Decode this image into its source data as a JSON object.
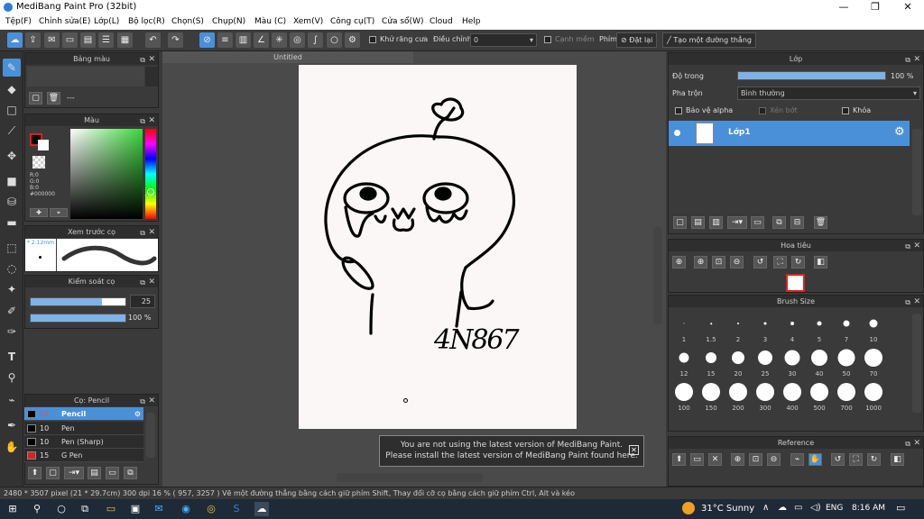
{
  "window": {
    "title": "MediBang Paint Pro (32bit)"
  },
  "menu": [
    "Tệp(F)",
    "Chỉnh sửa(E)",
    "Lớp(L)",
    "Bộ lọc(R)",
    "Chọn(S)",
    "Chụp(N)",
    "Màu (C)",
    "Xem(V)",
    "Công cụ(T)",
    "Cửa sổ(W)",
    "Cloud",
    "Help"
  ],
  "toolbar": {
    "antialias_label": "Khử răng cưa",
    "adjust_label": "Điều chỉnh",
    "adjust_value": "0",
    "soft_edge_label": "Cạnh mềm",
    "key_label": "Phím",
    "reset_label": "Đặt lại",
    "line_label": "Tạo một đường thẳng"
  },
  "panels": {
    "palette": "Bảng màu",
    "palette_item": "---",
    "color": "Màu",
    "color_r": "R:0",
    "color_g": "G:0",
    "color_b": "B:0",
    "color_hex": "#000000",
    "brush_preview": "Xem trước cọ",
    "brush_preview_size": "2.12mm",
    "brush_control": "Kiểm soát cọ",
    "brush_size_value": "25",
    "brush_opacity_value": "100 %",
    "brush_list": "Cọ: Pencil",
    "layer": "Lớp",
    "opacity_label": "Độ trong",
    "opacity_value": "100 %",
    "blend_label": "Pha trộn",
    "blend_value": "Bình thường",
    "protect_alpha": "Bảo vệ alpha",
    "clipping": "Xén bớt",
    "lock": "Khóa",
    "layer_name": "Lớp1",
    "navigator": "Hoa tiêu",
    "brush_size": "Brush Size",
    "reference": "Reference"
  },
  "brushes": [
    {
      "size": "25",
      "name": "Pencil",
      "color": "#000000",
      "selected": true
    },
    {
      "size": "10",
      "name": "Pen",
      "color": "#000000"
    },
    {
      "size": "10",
      "name": "Pen (Sharp)",
      "color": "#000000"
    },
    {
      "size": "15",
      "name": "G Pen",
      "color": "#e02020"
    }
  ],
  "brush_sizes": [
    "1",
    "1.5",
    "2",
    "3",
    "4",
    "5",
    "7",
    "10",
    "12",
    "15",
    "20",
    "25",
    "30",
    "40",
    "50",
    "70",
    "100",
    "150",
    "200",
    "300",
    "400",
    "500",
    "700",
    "1000"
  ],
  "document": {
    "tab": "Untitled",
    "signature": "4N867"
  },
  "notice": {
    "line1": "You are not using the latest version of MediBang Paint.",
    "line2": "Please install the latest version of MediBang Paint found here."
  },
  "status": "2480 * 3507 pixel  (21 * 29.7cm)  300 dpi  16 %  ( 957, 3257 )  Vẽ một đường thẳng bằng cách giữ phím Shift, Thay đổi cỡ cọ bằng cách giữ phím Ctrl, Alt và kéo",
  "taskbar": {
    "weather": "31°C  Sunny",
    "lang": "ENG",
    "time": "8:16 AM"
  },
  "colors": {
    "accent": "#4a90d9",
    "bg": "#3a3a3a"
  }
}
